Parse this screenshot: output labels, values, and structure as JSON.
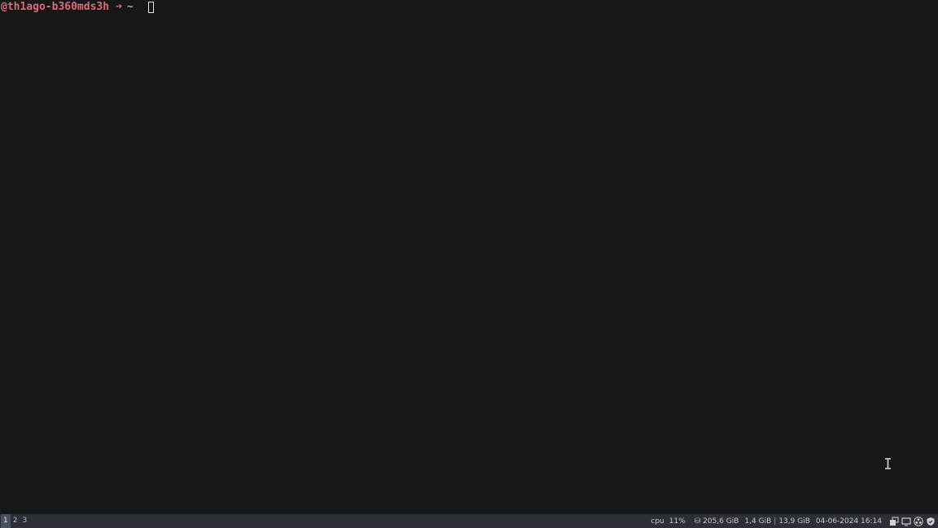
{
  "terminal": {
    "host": "@th1ago-b360mds3h",
    "arrow": "➜",
    "dir": "~"
  },
  "statusbar": {
    "workspaces": [
      "1",
      "2",
      "3"
    ],
    "active_workspace": "1",
    "cpu_label": "cpu",
    "cpu_value": "11%",
    "disk": "⛁ 205,6 GiB",
    "mem_used": "1,4 GiB",
    "mem_sep": "|",
    "mem_total": "13,9 GiB",
    "datetime": "04-06-2024 16:14"
  },
  "tray": {
    "icons": [
      "window-stack-icon",
      "display-icon",
      "obs-icon",
      "shield-icon"
    ]
  },
  "colors": {
    "background": "#171717",
    "prompt_accent": "#e06c75",
    "bar": "#2c2f35"
  }
}
